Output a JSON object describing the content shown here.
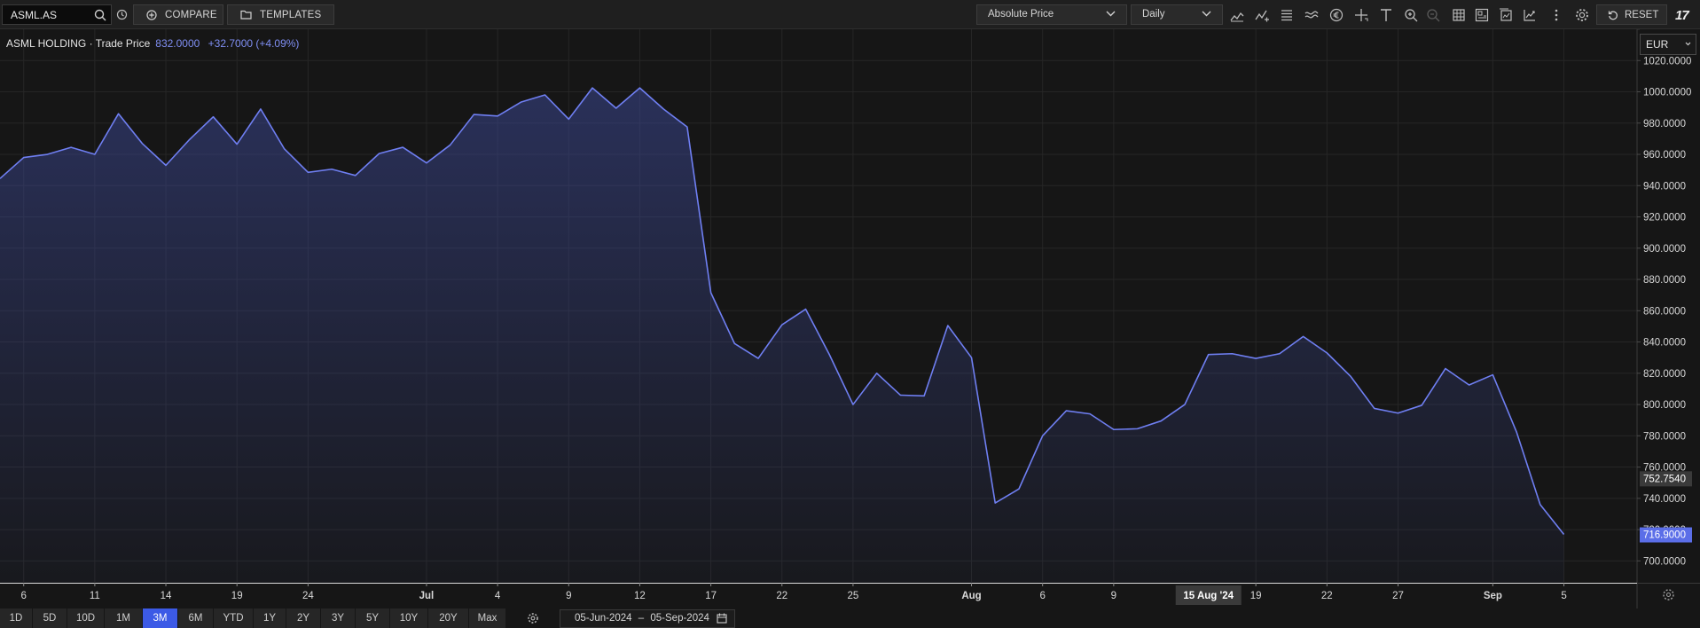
{
  "toolbar": {
    "symbol": "ASML.AS",
    "compare_label": "COMPARE",
    "templates_label": "TEMPLATES",
    "price_type": "Absolute Price",
    "interval": "Daily",
    "reset_label": "RESET",
    "logo_text": "17",
    "tools": [
      "chart-style-icon",
      "indicators-icon",
      "events-icon",
      "studies-icon",
      "currency-icon",
      "crosshair-icon",
      "text-tool-icon",
      "zoom-in-icon",
      "zoom-out-icon",
      "table-view-icon",
      "layout-icon",
      "save-image-icon",
      "fullscreen-icon",
      "more-icon",
      "settings-icon"
    ]
  },
  "legend": {
    "name": "ASML HOLDING · Trade Price",
    "price": "832.0000",
    "change": "+32.7000 (+4.09%)"
  },
  "currency": "EUR",
  "range_buttons": [
    "1D",
    "5D",
    "10D",
    "1M",
    "3M",
    "6M",
    "YTD",
    "1Y",
    "2Y",
    "3Y",
    "5Y",
    "10Y",
    "20Y",
    "Max"
  ],
  "active_range": "3M",
  "date_range": {
    "from": "05-Jun-2024",
    "separator": "–",
    "to": "05-Sep-2024"
  },
  "colors": {
    "line": "#6f7ff2",
    "last_price_badge": "#5b6ee8",
    "crosshair_badge": "#3a3a3a",
    "active_range": "#3c5ae6"
  },
  "chart_data": {
    "type": "area",
    "series": [
      {
        "name": "ASML HOLDING · Trade Price",
        "values": [
          944.5,
          958,
          960,
          964.5,
          960,
          986,
          967,
          953,
          969.5,
          984,
          966.5,
          989,
          963.5,
          948.5,
          950.5,
          946.5,
          960.5,
          964.5,
          954.5,
          966,
          985.5,
          984.5,
          993.5,
          998,
          982.5,
          1002.5,
          989.5,
          1002.5,
          989,
          977.5,
          871.5,
          839,
          829.5,
          851,
          861,
          832,
          800,
          820,
          806,
          805.5,
          850.5,
          830,
          737,
          746,
          780,
          796,
          794,
          784,
          784.5,
          789.5,
          800,
          832,
          832.5,
          829.5,
          832.5,
          843.5,
          833,
          818,
          797.5,
          794.5,
          799.5,
          823,
          812.5,
          819,
          782.5,
          736,
          716.9
        ]
      }
    ],
    "x_tick_labels": [
      {
        "label": "6",
        "index": 1
      },
      {
        "label": "11",
        "index": 4
      },
      {
        "label": "14",
        "index": 7
      },
      {
        "label": "19",
        "index": 10
      },
      {
        "label": "24",
        "index": 13
      },
      {
        "label": "Jul",
        "index": 18
      },
      {
        "label": "4",
        "index": 21
      },
      {
        "label": "9",
        "index": 24
      },
      {
        "label": "12",
        "index": 27
      },
      {
        "label": "17",
        "index": 30
      },
      {
        "label": "22",
        "index": 33
      },
      {
        "label": "25",
        "index": 36
      },
      {
        "label": "Aug",
        "index": 41
      },
      {
        "label": "6",
        "index": 44
      },
      {
        "label": "9",
        "index": 47
      },
      {
        "label": "19",
        "index": 53
      },
      {
        "label": "22",
        "index": 56
      },
      {
        "label": "27",
        "index": 59
      },
      {
        "label": "Sep",
        "index": 63
      },
      {
        "label": "5",
        "index": 66
      }
    ],
    "crosshair": {
      "label": "15 Aug '24",
      "index": 51,
      "price_label": "752.7540",
      "price": 752.754
    },
    "last_price_label": "716.9000",
    "last_price": 716.9,
    "y_ticks": [
      "700.0000",
      "720.0000",
      "740.0000",
      "760.0000",
      "780.0000",
      "800.0000",
      "820.0000",
      "840.0000",
      "860.0000",
      "880.0000",
      "900.0000",
      "920.0000",
      "940.0000",
      "960.0000",
      "980.0000",
      "1000.0000",
      "1020.0000"
    ],
    "ylim": [
      686,
      1040
    ],
    "grid": true,
    "legend": "top-left"
  }
}
